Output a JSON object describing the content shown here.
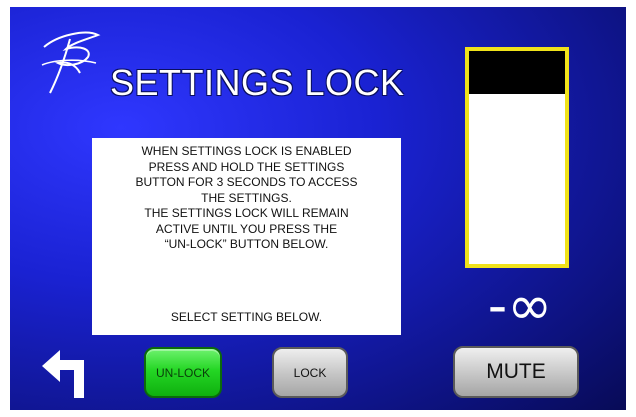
{
  "screen": {
    "title": "SETTINGS LOCK"
  },
  "icons": {
    "logo": "signature-logo",
    "back": "back-arrow-icon"
  },
  "info_panel": {
    "lines": [
      "WHEN SETTINGS LOCK IS ENABLED",
      "PRESS AND HOLD THE SETTINGS",
      "BUTTON FOR 3 SECONDS TO ACCESS",
      "THE SETTINGS.",
      "THE SETTINGS LOCK WILL REMAIN",
      "ACTIVE UNTIL YOU PRESS THE",
      "“UN-LOCK” BUTTON BELOW."
    ],
    "footer": "SELECT SETTING BELOW."
  },
  "level_meter": {
    "level_fraction": 0.2,
    "readout": "-∞"
  },
  "buttons": {
    "unlock": "UN-LOCK",
    "lock": "LOCK",
    "mute": "MUTE"
  },
  "colors": {
    "background": "#1a22d2",
    "meter_border": "#f0e21a",
    "unlock_active": "#24d624",
    "inactive_button": "#c4c4c4"
  }
}
